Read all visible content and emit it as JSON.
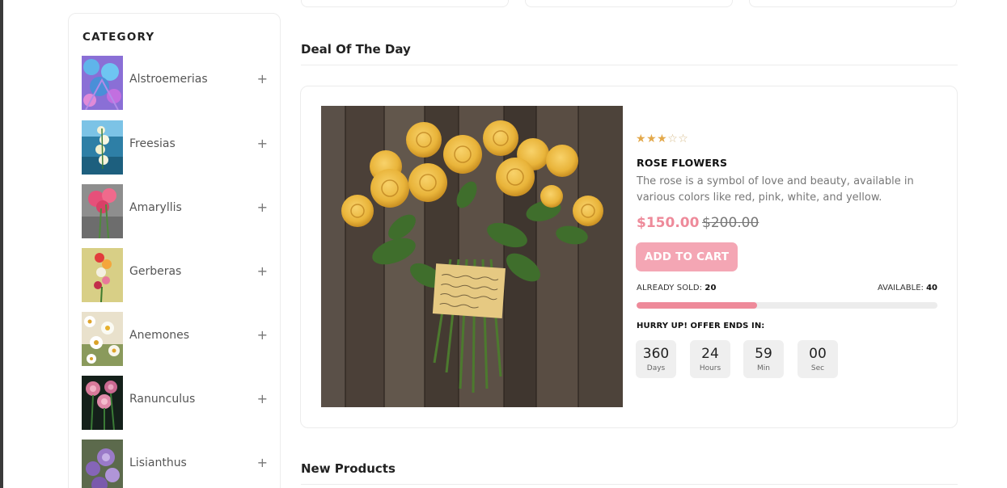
{
  "sidebar": {
    "title": "CATEGORY",
    "items": [
      {
        "label": "Alstroemerias",
        "expand_icon": "+"
      },
      {
        "label": "Freesias",
        "expand_icon": "+"
      },
      {
        "label": "Amaryllis",
        "expand_icon": "+"
      },
      {
        "label": "Gerberas",
        "expand_icon": "+"
      },
      {
        "label": "Anemones",
        "expand_icon": "+"
      },
      {
        "label": "Ranunculus",
        "expand_icon": "+"
      },
      {
        "label": "Lisianthus",
        "expand_icon": "+"
      }
    ]
  },
  "deal": {
    "section_title": "Deal Of The Day",
    "rating": {
      "value": 3,
      "max": 5
    },
    "product_name": "ROSE FLOWERS",
    "description": "The rose is a symbol of love and beauty, available in various colors like red, pink, white, and yellow.",
    "price": "$150.00",
    "old_price": "$200.00",
    "add_to_cart_label": "ADD TO CART",
    "sold_label": "ALREADY SOLD:",
    "sold_value": "20",
    "available_label": "AVAILABLE:",
    "available_value": "40",
    "sold_fraction": 0.4,
    "hurry_label": "HURRY UP! OFFER ENDS IN:",
    "countdown": [
      {
        "value": "360",
        "unit": "Days"
      },
      {
        "value": "24",
        "unit": "Hours"
      },
      {
        "value": "59",
        "unit": "Min"
      },
      {
        "value": "00",
        "unit": "Sec"
      }
    ]
  },
  "new_products": {
    "section_title": "New Products"
  },
  "colors": {
    "accent_pink": "#ee8a9a",
    "button_pink": "#f4a6b4",
    "star_gold": "#e3a84a"
  }
}
